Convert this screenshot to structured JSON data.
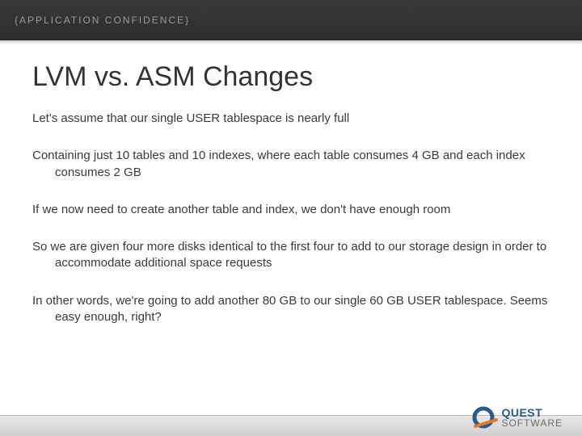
{
  "header": {
    "tagline": "{APPLICATION CONFIDENCE}"
  },
  "slide": {
    "title": "LVM vs. ASM Changes",
    "paragraphs": [
      "Let's assume that our single USER tablespace is nearly full",
      "Containing just 10 tables and 10 indexes, where each table consumes 4 GB and each index consumes 2 GB",
      "If we now need to create another table and index, we don't have enough room",
      "So we are given four more disks identical to the first four to add to our storage design in order to accommodate additional space requests",
      "In other words, we're going to add another 80 GB to our single 60 GB USER tablespace. Seems easy enough, right?"
    ]
  },
  "footer": {
    "logo": {
      "line1": "QUEST",
      "line2": "SOFTWARE",
      "icon_name": "quest-q-icon",
      "accent_color": "#2a5a8a",
      "swoosh_color": "#e07a2a"
    }
  }
}
